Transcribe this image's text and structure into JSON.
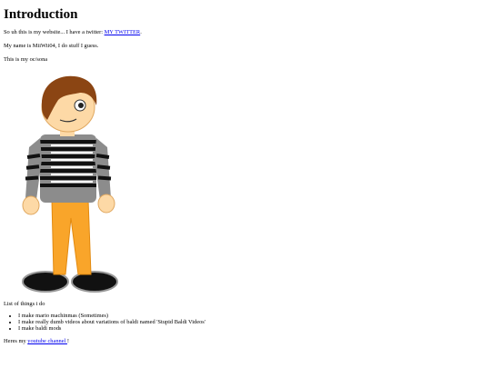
{
  "heading": "Introduction",
  "intro": {
    "text": "So uh this is my website... I have a twitter: ",
    "twitter_link": "MY TWITTER",
    "suffix": "."
  },
  "name_line": "My name is MiiWii04, I do stuff I guess.",
  "oc_caption": "This is my oc/sona",
  "list_title": "List of things i do",
  "things": [
    "I make mario machinmas (Sometimes)",
    "I make really dumb videos about variations of baldi named 'Stupid Baldi Videos'",
    "I make baldi mods"
  ],
  "channel": {
    "prefix": "Heres my ",
    "link": "youtube channel ",
    "suffix": "!"
  },
  "colors": {
    "link": "#0000ee",
    "hair": "#8b4513",
    "skin": "#fdd9a6",
    "pants": "#f9a52a",
    "shirt_gray": "#8c8c8c",
    "shirt_stripe": "#111111",
    "shoe": "#111111"
  }
}
